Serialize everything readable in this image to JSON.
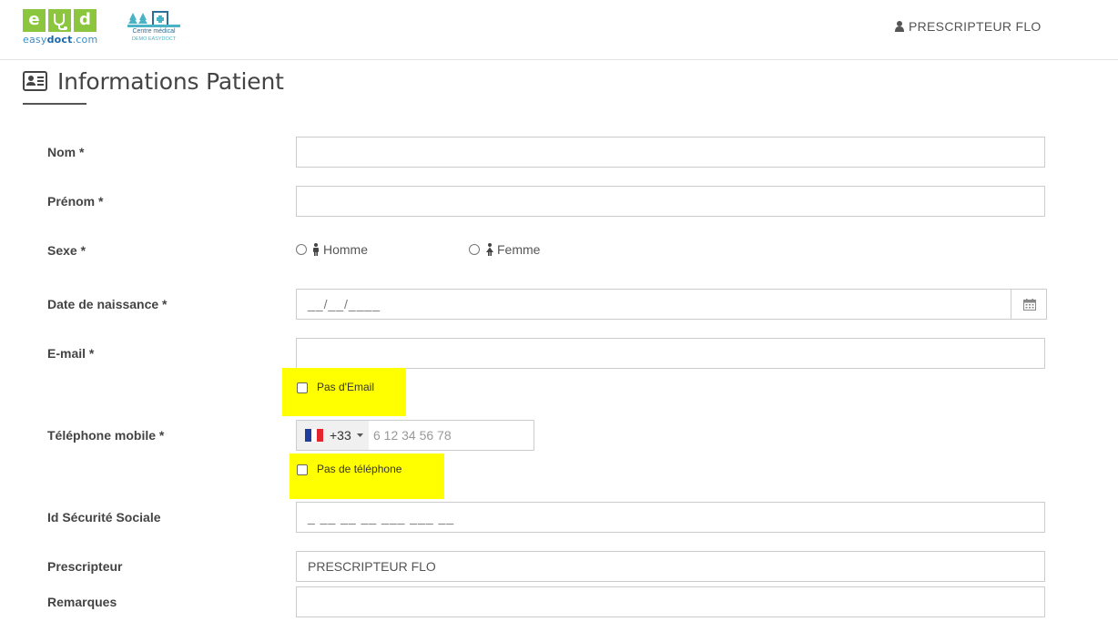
{
  "header": {
    "logo": {
      "letters": [
        "e",
        "d"
      ],
      "text_a": "easy",
      "text_b": "doct",
      "text_c": ".com"
    },
    "centre": {
      "line1": "Centre médical",
      "line2": "DEMO EASYDOCT"
    },
    "user_label": "PRESCRIPTEUR FLO"
  },
  "page": {
    "title": "Informations Patient"
  },
  "form": {
    "nom": {
      "label": "Nom *",
      "value": ""
    },
    "prenom": {
      "label": "Prénom *",
      "value": ""
    },
    "sexe": {
      "label": "Sexe *",
      "options": [
        "Homme",
        "Femme"
      ]
    },
    "naissance": {
      "label": "Date de naissance *",
      "placeholder": "__/__/____"
    },
    "email": {
      "label": "E-mail *",
      "value": "",
      "no_email_label": "Pas d'Email"
    },
    "telephone": {
      "label": "Téléphone mobile *",
      "country_code": "+33",
      "placeholder": "6 12 34 56 78",
      "no_phone_label": "Pas de téléphone"
    },
    "secu": {
      "label": "Id Sécurité Sociale",
      "placeholder": "_ __ __ __ ___ ___ __"
    },
    "prescripteur": {
      "label": "Prescripteur",
      "value": "PRESCRIPTEUR FLO"
    },
    "remarques": {
      "label": "Remarques",
      "value": ""
    }
  },
  "colors": {
    "logo_green": "#8cc63f",
    "highlight": "#ffff00",
    "brand_blue": "#3a8dc8"
  }
}
